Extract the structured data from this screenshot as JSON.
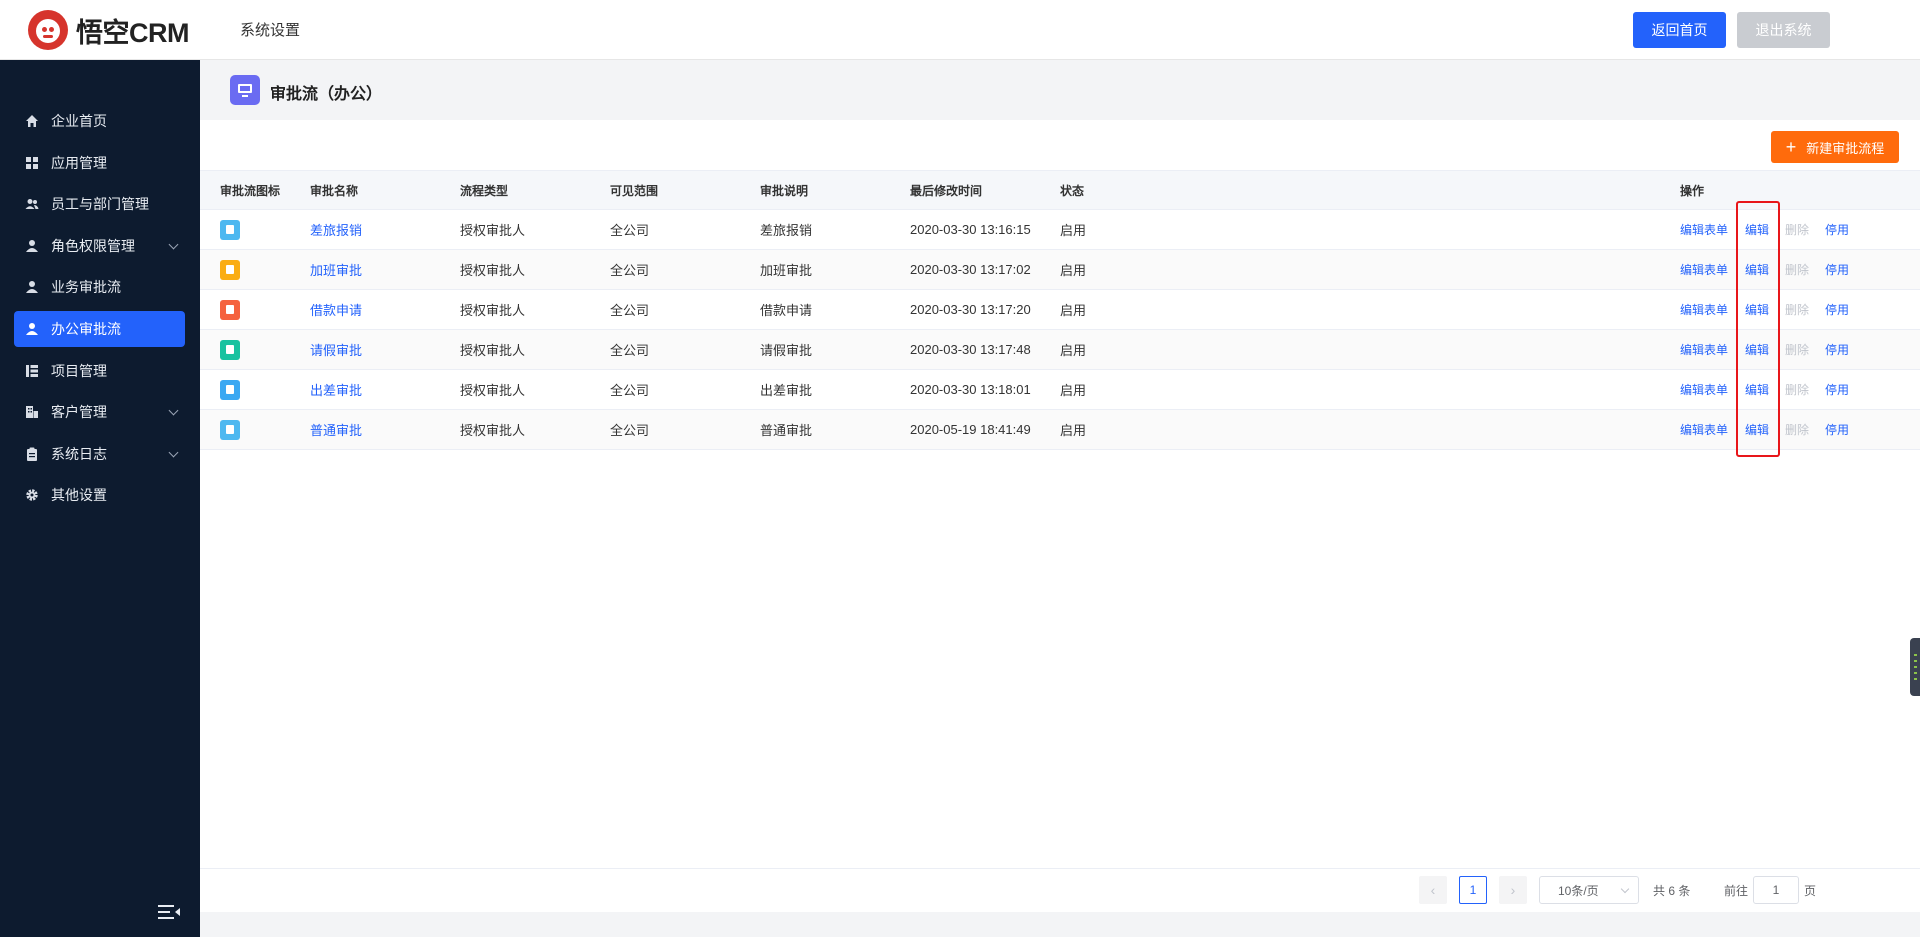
{
  "header": {
    "logo_text": "悟空CRM",
    "title": "系统设置",
    "home_button": "返回首页",
    "exit_button": "退出系统",
    "colors": {
      "primary": "#2362FB",
      "disabled": "#C9CCD1",
      "logo_red": "#D6342C"
    }
  },
  "sidebar": {
    "items": [
      {
        "label": "企业首页",
        "icon": "home-icon"
      },
      {
        "label": "应用管理",
        "icon": "grid-icon"
      },
      {
        "label": "员工与部门管理",
        "icon": "users-icon"
      },
      {
        "label": "角色权限管理",
        "icon": "user-icon",
        "expandable": true
      },
      {
        "label": "业务审批流",
        "icon": "user-icon"
      },
      {
        "label": "办公审批流",
        "icon": "user-icon",
        "active": true
      },
      {
        "label": "项目管理",
        "icon": "list-icon"
      },
      {
        "label": "客户管理",
        "icon": "building-icon",
        "expandable": true
      },
      {
        "label": "系统日志",
        "icon": "clipboard-icon",
        "expandable": true
      },
      {
        "label": "其他设置",
        "icon": "gear-icon"
      }
    ],
    "collapse_icon": "menu-collapse-icon"
  },
  "page": {
    "title": "审批流（办公）",
    "new_button": "新建审批流程",
    "new_button_icon": "plus-icon"
  },
  "table": {
    "columns": [
      "审批流图标",
      "审批名称",
      "流程类型",
      "可见范围",
      "审批说明",
      "最后修改时间",
      "状态",
      "操作"
    ],
    "rows": [
      {
        "icon_color": "#4DB8F0",
        "name": "差旅报销",
        "type": "授权审批人",
        "scope": "全公司",
        "desc": "差旅报销",
        "time": "2020-03-30 13:16:15",
        "status": "启用"
      },
      {
        "icon_color": "#FAAD14",
        "name": "加班审批",
        "type": "授权审批人",
        "scope": "全公司",
        "desc": "加班审批",
        "time": "2020-03-30 13:17:02",
        "status": "启用"
      },
      {
        "icon_color": "#F5623E",
        "name": "借款申请",
        "type": "授权审批人",
        "scope": "全公司",
        "desc": "借款申请",
        "time": "2020-03-30 13:17:20",
        "status": "启用"
      },
      {
        "icon_color": "#19C2A0",
        "name": "请假审批",
        "type": "授权审批人",
        "scope": "全公司",
        "desc": "请假审批",
        "time": "2020-03-30 13:17:48",
        "status": "启用"
      },
      {
        "icon_color": "#3AA8F2",
        "name": "出差审批",
        "type": "授权审批人",
        "scope": "全公司",
        "desc": "出差审批",
        "time": "2020-03-30 13:18:01",
        "status": "启用"
      },
      {
        "icon_color": "#4DB8F0",
        "name": "普通审批",
        "type": "授权审批人",
        "scope": "全公司",
        "desc": "普通审批",
        "time": "2020-05-19 18:41:49",
        "status": "启用"
      }
    ],
    "ops": {
      "edit_form": "编辑表单",
      "edit": "编辑",
      "delete": "删除",
      "disable": "停用"
    }
  },
  "pagination": {
    "prev_icon": "chevron-left-icon",
    "next_icon": "chevron-right-icon",
    "current_page": "1",
    "page_size": "10条/页",
    "total": "共 6 条",
    "goto_label": "前往",
    "goto_value": "1",
    "goto_unit": "页"
  }
}
